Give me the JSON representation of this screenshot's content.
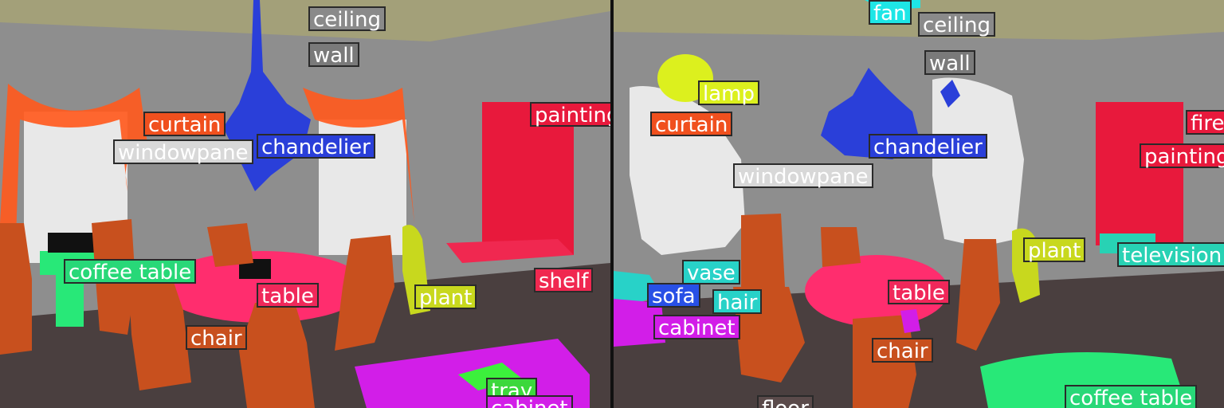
{
  "colors": {
    "ceiling": "#a3a079",
    "wall": "#8a8a8a",
    "curtain": "#ff5a1e",
    "windowpane": "#e8e8e8",
    "chandelier": "#2a3fd9",
    "painting": "#e8193c",
    "fire": "#e8193c",
    "shelf": "#f02850",
    "plant": "#c8d81e",
    "coffee_table": "#28e878",
    "table": "#ff2d6e",
    "chair": "#c8501e",
    "tray": "#3cf03c",
    "cabinet": "#d21ee8",
    "lamp": "#dcf01e",
    "fan": "#1ee6e6",
    "vase": "#28d2c8",
    "sofa": "#2850e6",
    "television": "#28d2b4",
    "floor": "#5a4a4a"
  },
  "panels": [
    {
      "id": "left",
      "labels": [
        {
          "name": "ceiling",
          "text": "ceiling",
          "color": "#8a8a8a",
          "textColor": "#ffffff"
        },
        {
          "name": "wall",
          "text": "wall",
          "color": "#7a7a7a",
          "textColor": "#ffffff"
        },
        {
          "name": "curtain",
          "text": "curtain",
          "color": "#f0501e",
          "textColor": "#ffffff"
        },
        {
          "name": "windowpane",
          "text": "windowpane",
          "color": "#d8d8d8",
          "textColor": "#ffffff"
        },
        {
          "name": "chandelier",
          "text": "chandelier",
          "color": "#2a3fd9",
          "textColor": "#ffffff"
        },
        {
          "name": "painting",
          "text": "painting",
          "color": "#e8193c",
          "textColor": "#ffffff"
        },
        {
          "name": "shelf",
          "text": "shelf",
          "color": "#f02850",
          "textColor": "#ffffff"
        },
        {
          "name": "coffee-table",
          "text": "coffee table",
          "color": "#28d878",
          "textColor": "#ffffff"
        },
        {
          "name": "table",
          "text": "table",
          "color": "#f0285a",
          "textColor": "#ffffff"
        },
        {
          "name": "plant",
          "text": "plant",
          "color": "#c8d81e",
          "textColor": "#ffffff"
        },
        {
          "name": "chair",
          "text": "chair",
          "color": "#c8501e",
          "textColor": "#ffffff"
        },
        {
          "name": "tray",
          "text": "tray",
          "color": "#3cd83c",
          "textColor": "#ffffff"
        },
        {
          "name": "cabinet",
          "text": "cabinet",
          "color": "#d21ee8",
          "textColor": "#ffffff"
        }
      ]
    },
    {
      "id": "right",
      "labels": [
        {
          "name": "fan",
          "text": "fan",
          "color": "#1ee6e6",
          "textColor": "#ffffff"
        },
        {
          "name": "ceiling",
          "text": "ceiling",
          "color": "#8a8a8a",
          "textColor": "#ffffff"
        },
        {
          "name": "wall",
          "text": "wall",
          "color": "#7a7a7a",
          "textColor": "#ffffff"
        },
        {
          "name": "lamp",
          "text": "lamp",
          "color": "#dcf01e",
          "textColor": "#ffffff"
        },
        {
          "name": "curtain",
          "text": "curtain",
          "color": "#f0501e",
          "textColor": "#ffffff"
        },
        {
          "name": "fire",
          "text": "fire",
          "color": "#e8193c",
          "textColor": "#ffffff"
        },
        {
          "name": "chandelier",
          "text": "chandelier",
          "color": "#2a3fd9",
          "textColor": "#ffffff"
        },
        {
          "name": "painting",
          "text": "painting",
          "color": "#e8193c",
          "textColor": "#ffffff"
        },
        {
          "name": "windowpane",
          "text": "windowpane",
          "color": "#d8d8d8",
          "textColor": "#ffffff"
        },
        {
          "name": "plant",
          "text": "plant",
          "color": "#c8d81e",
          "textColor": "#ffffff"
        },
        {
          "name": "television",
          "text": "television",
          "color": "#28d2b4",
          "textColor": "#ffffff"
        },
        {
          "name": "vase",
          "text": "vase",
          "color": "#28d2c8",
          "textColor": "#ffffff"
        },
        {
          "name": "chair-partial",
          "text": "hair",
          "color": "#28d2c8",
          "textColor": "#ffffff"
        },
        {
          "name": "sofa",
          "text": "sofa",
          "color": "#2850e6",
          "textColor": "#ffffff"
        },
        {
          "name": "table",
          "text": "table",
          "color": "#f0285a",
          "textColor": "#ffffff"
        },
        {
          "name": "cabinet",
          "text": "cabinet",
          "color": "#d21ee8",
          "textColor": "#ffffff"
        },
        {
          "name": "chair",
          "text": "chair",
          "color": "#c8501e",
          "textColor": "#ffffff"
        },
        {
          "name": "coffee-table",
          "text": "coffee table",
          "color": "#28d878",
          "textColor": "#ffffff"
        },
        {
          "name": "floor",
          "text": "floor",
          "color": "#5a4a4a",
          "textColor": "#ffffff"
        }
      ]
    }
  ]
}
